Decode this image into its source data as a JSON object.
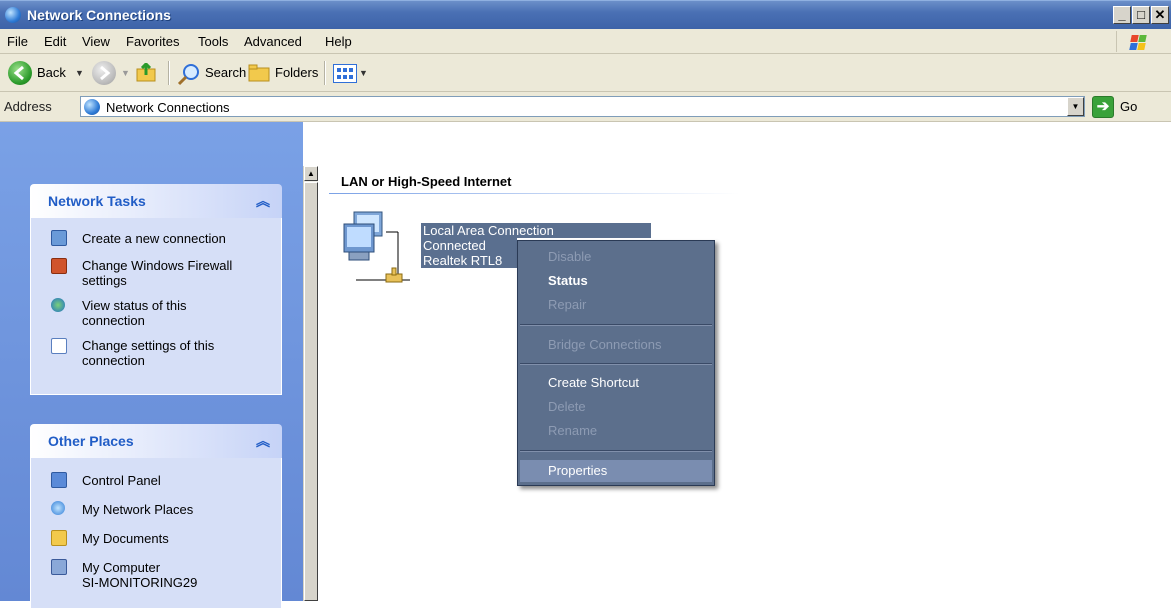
{
  "window": {
    "title": "Network Connections",
    "controls": {
      "minimize": "_",
      "maximize": "□",
      "close": "✕"
    }
  },
  "menubar": {
    "items": [
      "File",
      "Edit",
      "View",
      "Favorites",
      "Tools",
      "Advanced",
      "Help"
    ]
  },
  "toolbar": {
    "back_label": "Back",
    "search_label": "Search",
    "folders_label": "Folders"
  },
  "address": {
    "label": "Address",
    "value": "Network Connections",
    "go_label": "Go"
  },
  "network_tasks": {
    "title": "Network Tasks",
    "items": [
      {
        "label": "Create a new connection",
        "icon": "new-connection-icon"
      },
      {
        "label": "Change Windows Firewall settings",
        "icon": "firewall-icon"
      },
      {
        "label": "View status of this connection",
        "icon": "status-icon"
      },
      {
        "label": "Change settings of this connection",
        "icon": "settings-icon"
      }
    ]
  },
  "other_places": {
    "title": "Other Places",
    "items": [
      {
        "label": "Control Panel",
        "icon": "control-panel-icon"
      },
      {
        "label": "My Network Places",
        "icon": "network-places-icon"
      },
      {
        "label": "My Documents",
        "icon": "documents-icon"
      },
      {
        "label": "My Computer",
        "icon": "computer-icon"
      }
    ],
    "computer_name": "SI-MONITORING29"
  },
  "content": {
    "group_title": "LAN or High-Speed Internet",
    "connection": {
      "name": "Local Area Connection",
      "status": "Connected",
      "device": "Realtek RTL8"
    }
  },
  "context_menu": {
    "items": [
      {
        "label": "Disable",
        "enabled": false
      },
      {
        "label": "Status",
        "enabled": true,
        "bold": true
      },
      {
        "label": "Repair",
        "enabled": false
      },
      {
        "label": "Bridge Connections",
        "enabled": false
      },
      {
        "label": "Create Shortcut",
        "enabled": true
      },
      {
        "label": "Delete",
        "enabled": false
      },
      {
        "label": "Rename",
        "enabled": false
      },
      {
        "label": "Properties",
        "enabled": true,
        "highlighted": true
      }
    ]
  },
  "colors": {
    "titlebar": "#4a70b4",
    "chrome": "#ece9d8",
    "sidebar": "#7aa1e6",
    "panel_title": "#215dc6",
    "context_menu_bg": "#5c6f8c",
    "selection": "#5a6f8f"
  }
}
